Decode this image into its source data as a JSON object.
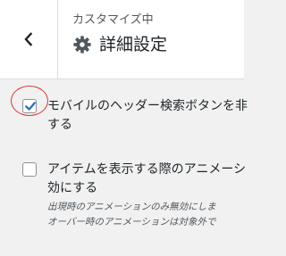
{
  "header": {
    "back_icon": "chevron-left-icon",
    "subtitle": "カスタマイズ中",
    "title_icon": "gear-icon",
    "title": "詳細設定"
  },
  "options": [
    {
      "checked": true,
      "label_line1": "モバイルのヘッダー検索ボタンを非",
      "label_line2": "する"
    },
    {
      "checked": false,
      "label_line1": "アイテムを表示する際のアニメーシ",
      "label_line2": "効にする",
      "desc_line1": "出現時のアニメーションのみ無効にしま",
      "desc_line2": "オーバー時のアニメーションは対象外で"
    }
  ],
  "colors": {
    "accent": "#2271b1",
    "focus_ring": "#d63638",
    "background": "#f1f1f1"
  }
}
